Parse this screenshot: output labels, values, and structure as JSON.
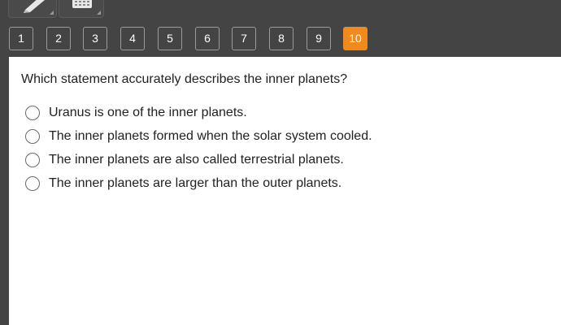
{
  "toolbar": {
    "tools": [
      {
        "name": "pencil-tool",
        "icon": "pencil-icon"
      },
      {
        "name": "calculator-tool",
        "icon": "calculator-icon"
      }
    ]
  },
  "nav": {
    "pages": [
      "1",
      "2",
      "3",
      "4",
      "5",
      "6",
      "7",
      "8",
      "9",
      "10"
    ],
    "active_page": "10",
    "active_color": "#f08a1c"
  },
  "question": {
    "text": "Which statement accurately describes the inner planets?",
    "options": [
      "Uranus is one of the inner planets.",
      "The inner planets formed when the solar system cooled.",
      "The inner planets are also called terrestrial planets.",
      "The inner planets are larger than the outer planets."
    ]
  }
}
